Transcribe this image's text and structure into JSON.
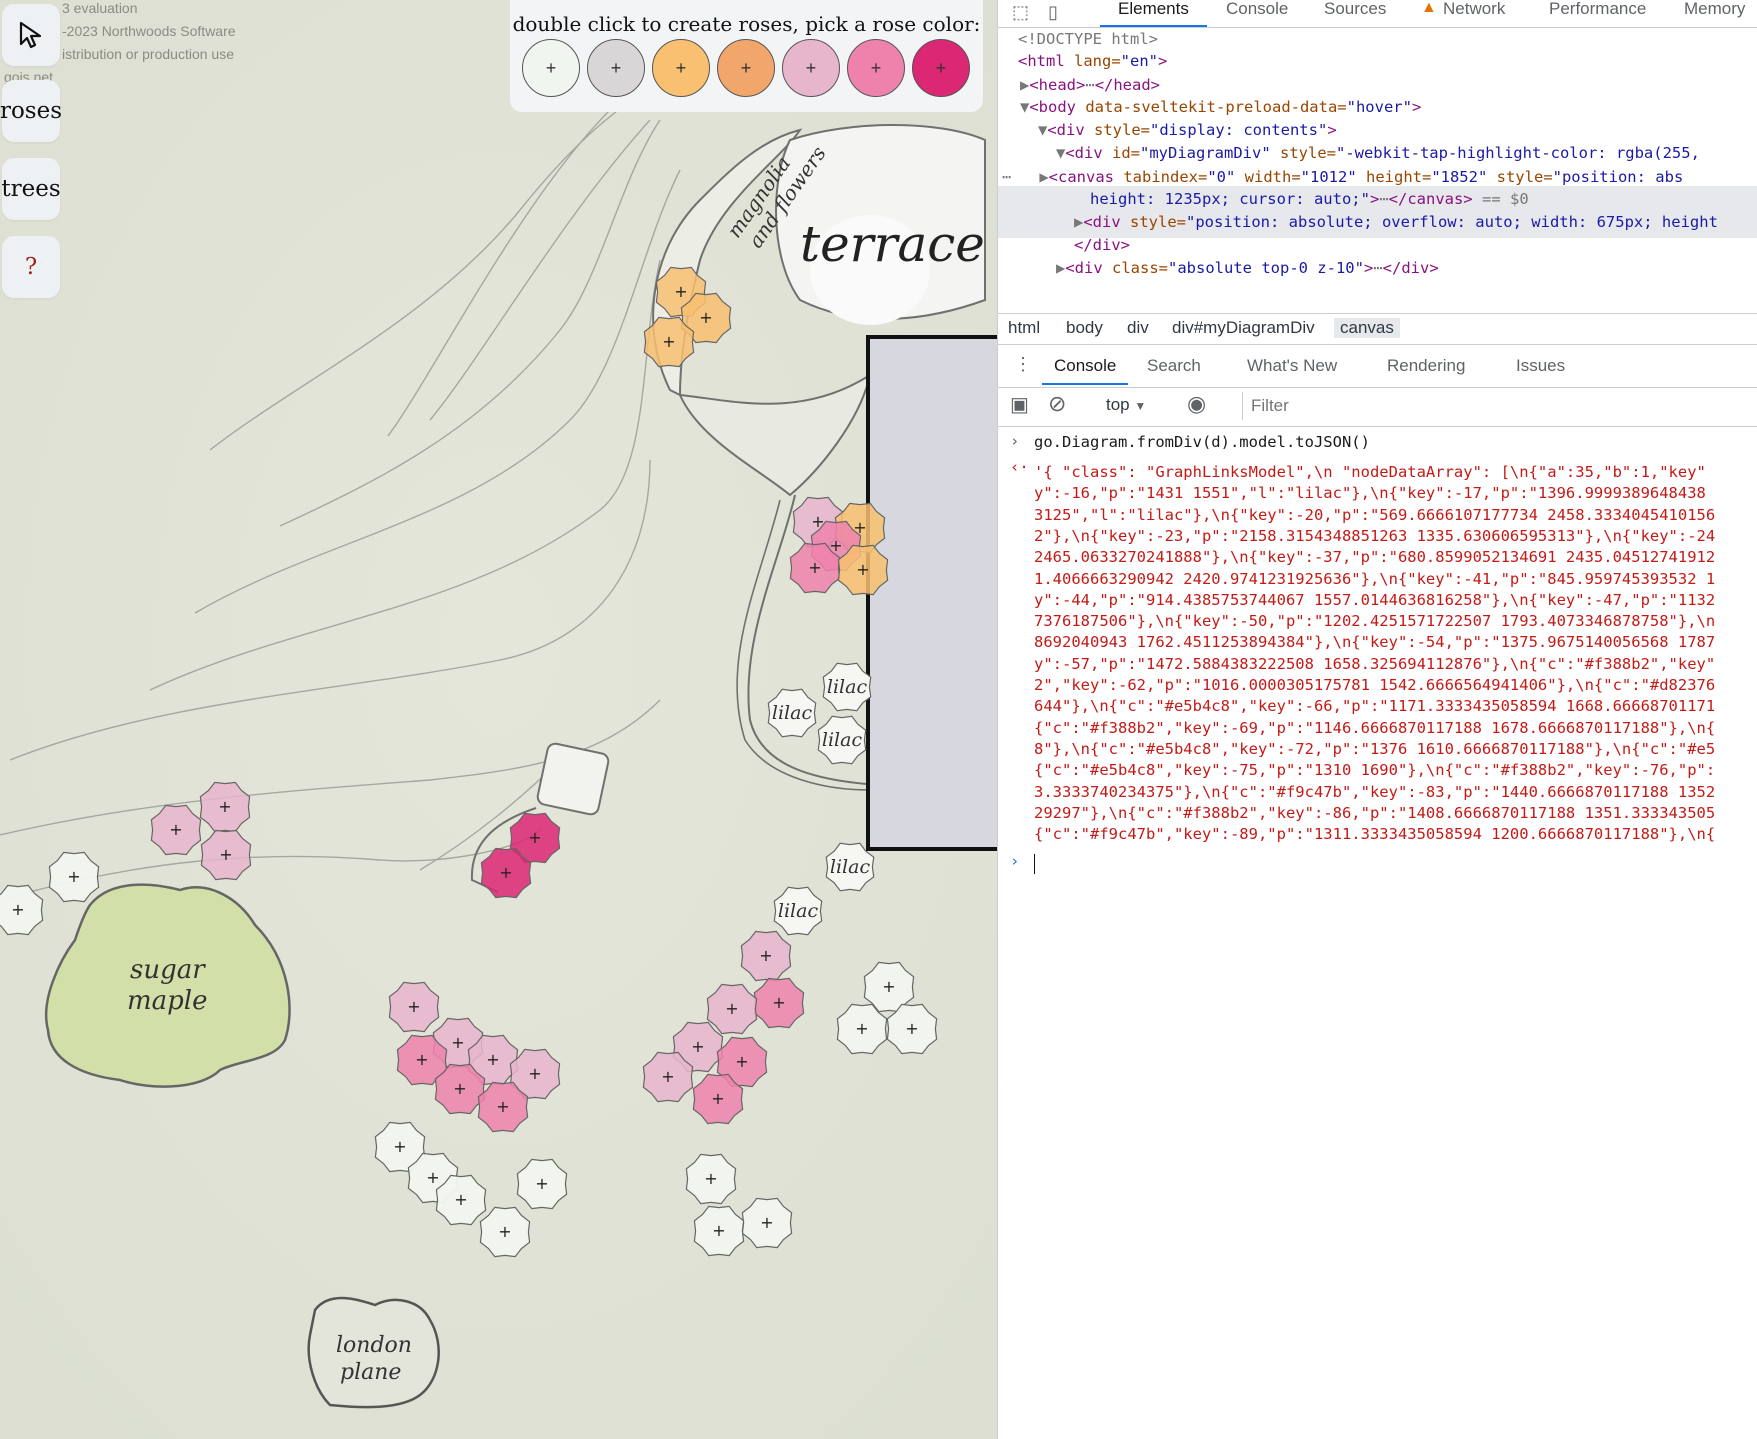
{
  "map": {
    "watermark_lines": [
      "3 evaluation",
      "-2023 Northwoods Software",
      "istribution or production use",
      "gojs.net"
    ],
    "tools": {
      "pointer": "pointer-tool",
      "roses": "roses",
      "trees": "trees",
      "help": "?"
    },
    "palette": {
      "title": "double click to create roses, pick a rose color:",
      "colors": [
        "#f1f5ef",
        "#d9d6d8",
        "#f8c070",
        "#f1a66c",
        "#e7b5cc",
        "#ef82ad",
        "#dc2774"
      ],
      "plus": "+"
    },
    "labels": {
      "terrace": "terrace",
      "magnolia": "magnolia",
      "and_flowers": "and flowers",
      "sugar": "sugar",
      "maple": "maple",
      "london": "london",
      "plane": "plane",
      "lilac": "lilac"
    }
  },
  "devtools": {
    "tabs": [
      "Elements",
      "Console",
      "Sources",
      "Network",
      "Performance",
      "Memory"
    ],
    "active_tab": "Elements",
    "dom": {
      "doctype": "<!DOCTYPE html>",
      "html_open": "<html",
      "html_attr": " lang=",
      "html_val": "\"en\"",
      "head": "<head>",
      "head_close": "</head>",
      "body_open": "<body",
      "body_attr": " data-sveltekit-preload-data=",
      "body_val": "\"hover\"",
      "div_open": "<div",
      "div_attr": " style=",
      "div_val": "\"display: contents\"",
      "diagram_attr1": " id=",
      "diagram_val1": "\"myDiagramDiv\"",
      "diagram_attr2": " style=",
      "diagram_val2": "\"-webkit-tap-highlight-color: rgba(255,",
      "canvas_open": "<canvas",
      "canvas_attr1": " tabindex=",
      "canvas_val1": "\"0\"",
      "canvas_attr2": " width=",
      "canvas_val2": "\"1012\"",
      "canvas_attr3": " height=",
      "canvas_val3": "\"1852\"",
      "canvas_attr4": " style=",
      "canvas_val4": "\"position: abs",
      "canvas_val4b": "height: 1235px; cursor: auto;\"",
      "canvas_close": "</canvas>",
      "canvas_ref": " == $0",
      "div2_val": "\"position: absolute; overflow: auto; width: 675px; height",
      "div_close": "</div>",
      "div3_attr": " class=",
      "div3_val": "\"absolute top-0 z-10\"",
      "div3_close": "</div>"
    },
    "breadcrumbs": [
      "html",
      "body",
      "div",
      "div#myDiagramDiv",
      "canvas"
    ],
    "drawer_tabs": [
      "Console",
      "Search",
      "What's New",
      "Rendering",
      "Issues"
    ],
    "context": "top",
    "filter_placeholder": "Filter",
    "command": "go.Diagram.fromDiv(d).model.toJSON()",
    "output_lines": [
      "'{ \"class\": \"GraphLinksModel\",\\n  \"nodeDataArray\": [\\n{\"a\":35,\"b\":1,\"key\"",
      "y\":-16,\"p\":\"1431 1551\",\"l\":\"lilac\"},\\n{\"key\":-17,\"p\":\"1396.9999389648438",
      "3125\",\"l\":\"lilac\"},\\n{\"key\":-20,\"p\":\"569.6666107177734 2458.3334045410156",
      "2\"},\\n{\"key\":-23,\"p\":\"2158.3154348851263 1335.630606595313\"},\\n{\"key\":-24",
      "2465.0633270241888\"},\\n{\"key\":-37,\"p\":\"680.8599052134691 2435.04512741912",
      "1.4066663290942 2420.9741231925636\"},\\n{\"key\":-41,\"p\":\"845.959745393532 1",
      "y\":-44,\"p\":\"914.4385753744067 1557.0144636816258\"},\\n{\"key\":-47,\"p\":\"1132",
      "7376187506\"},\\n{\"key\":-50,\"p\":\"1202.4251571722507 1793.4073346878758\"},\\n",
      "8692040943 1762.4511253894384\"},\\n{\"key\":-54,\"p\":\"1375.9675140056568 1787",
      "y\":-57,\"p\":\"1472.5884383222508 1658.325694112876\"},\\n{\"c\":\"#f388b2\",\"key\"",
      "2\",\"key\":-62,\"p\":\"1016.0000305175781 1542.6666564941406\"},\\n{\"c\":\"#d82376",
      "644\"},\\n{\"c\":\"#e5b4c8\",\"key\":-66,\"p\":\"1171.3333435058594 1668.66668701171",
      "{\"c\":\"#f388b2\",\"key\":-69,\"p\":\"1146.6666870117188 1678.6666870117188\"},\\n{",
      "8\"},\\n{\"c\":\"#e5b4c8\",\"key\":-72,\"p\":\"1376 1610.6666870117188\"},\\n{\"c\":\"#e5",
      "{\"c\":\"#e5b4c8\",\"key\":-75,\"p\":\"1310 1690\"},\\n{\"c\":\"#f388b2\",\"key\":-76,\"p\":",
      "3.3333740234375\"},\\n{\"c\":\"#f9c47b\",\"key\":-83,\"p\":\"1440.6666870117188 1352",
      "29297\"},\\n{\"c\":\"#f388b2\",\"key\":-86,\"p\":\"1408.6666870117188 1351.333343505",
      "{\"c\":\"#f9c47b\",\"key\":-89,\"p\":\"1311.3333435058594 1200.6666870117188\"},\\n{"
    ]
  }
}
